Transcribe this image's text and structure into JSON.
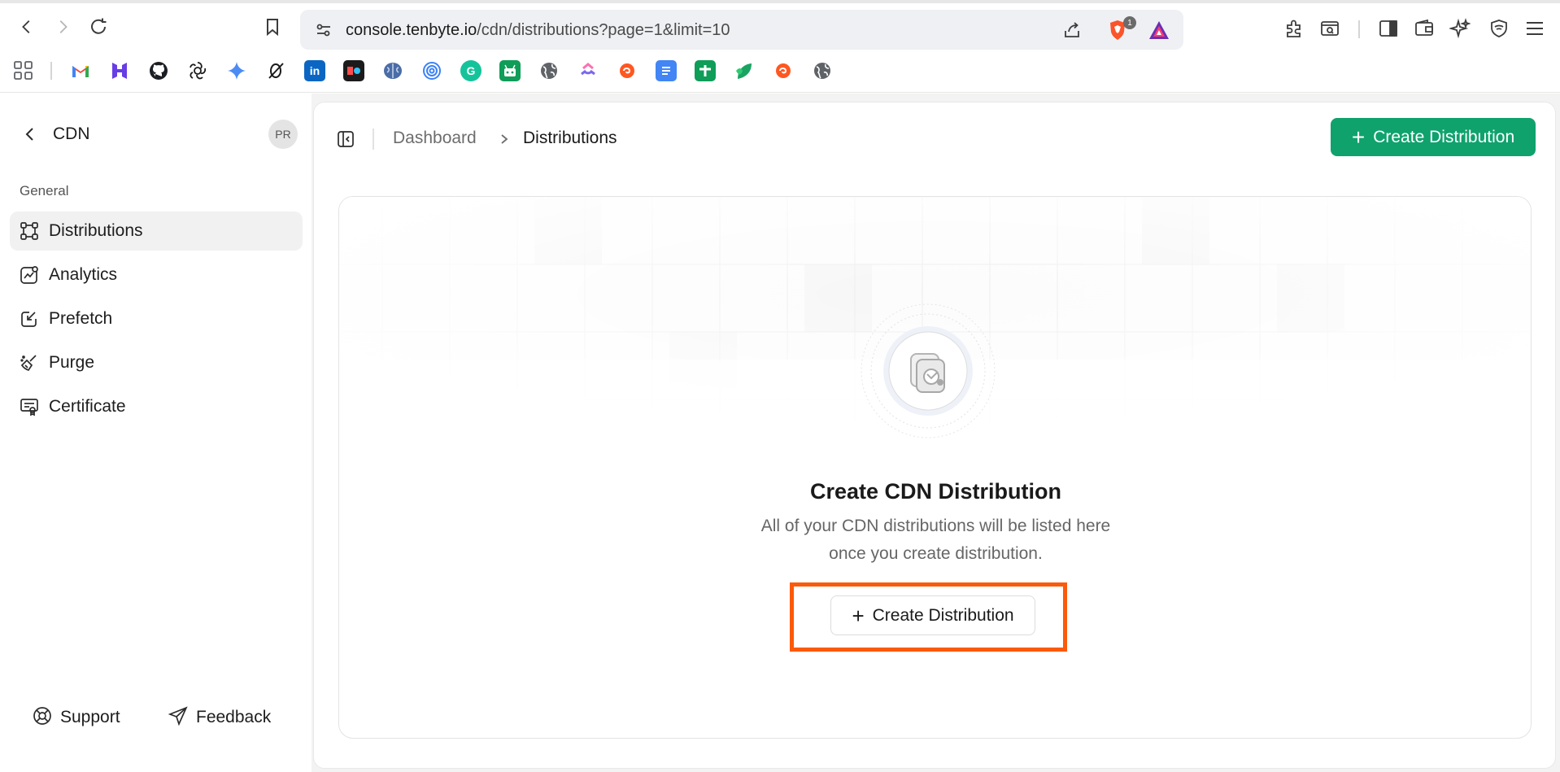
{
  "browser": {
    "url_host": "console.tenbyte.io",
    "url_path": "/cdn/distributions?page=1&limit=10",
    "brave_badge": "1"
  },
  "bookmarks": [
    {
      "icon": "apps-grid-icon",
      "color": "#5f6368"
    },
    {
      "icon": "gmail-icon",
      "color": "#ea4335",
      "text": "M"
    },
    {
      "icon": "hostinger-icon",
      "color": "#673de6",
      "text": "H"
    },
    {
      "icon": "github-icon",
      "color": "#1b1f23"
    },
    {
      "icon": "openai-icon",
      "color": "#1b1b1b"
    },
    {
      "icon": "gemini-icon",
      "color": "#4b8bf5"
    },
    {
      "icon": "perplexity-icon",
      "color": "#1b1b1b"
    },
    {
      "icon": "linkedin-icon",
      "color": "#0a66c2",
      "text": "in"
    },
    {
      "icon": "app-icon",
      "color": "#1b1b1b"
    },
    {
      "icon": "brain-icon",
      "color": "#4a6da7"
    },
    {
      "icon": "spiral-icon",
      "color": "#3b82f6"
    },
    {
      "icon": "grammarly-icon",
      "color": "#15c39a",
      "text": "G"
    },
    {
      "icon": "android-icon",
      "color": "#0f9d58"
    },
    {
      "icon": "globe-icon",
      "color": "#5f6368"
    },
    {
      "icon": "clickup-icon",
      "color": "#7b68ee"
    },
    {
      "icon": "swirl-icon",
      "color": "#ff5722"
    },
    {
      "icon": "docs-icon",
      "color": "#4285f4"
    },
    {
      "icon": "sheets-icon",
      "color": "#0f9d58"
    },
    {
      "icon": "leaf-icon",
      "color": "#19a463"
    },
    {
      "icon": "swirl-icon-2",
      "color": "#ff5722"
    },
    {
      "icon": "globe-icon-2",
      "color": "#5f6368"
    }
  ],
  "sidebar": {
    "title": "CDN",
    "avatar": "PR",
    "section": "General",
    "items": [
      {
        "label": "Distributions",
        "icon": "distributions-icon",
        "active": true
      },
      {
        "label": "Analytics",
        "icon": "analytics-icon"
      },
      {
        "label": "Prefetch",
        "icon": "prefetch-icon"
      },
      {
        "label": "Purge",
        "icon": "purge-icon"
      },
      {
        "label": "Certificate",
        "icon": "certificate-icon"
      }
    ],
    "support_label": "Support",
    "feedback_label": "Feedback"
  },
  "header": {
    "breadcrumb": [
      "Dashboard",
      "Distributions"
    ],
    "primary_button": "Create Distribution"
  },
  "empty_state": {
    "title": "Create CDN Distribution",
    "desc_line1": "All of your CDN distributions will be listed here",
    "desc_line2": "once you create distribution.",
    "button": "Create Distribution"
  },
  "colors": {
    "accent": "#0fa26d",
    "highlight": "#fc5a0a"
  }
}
